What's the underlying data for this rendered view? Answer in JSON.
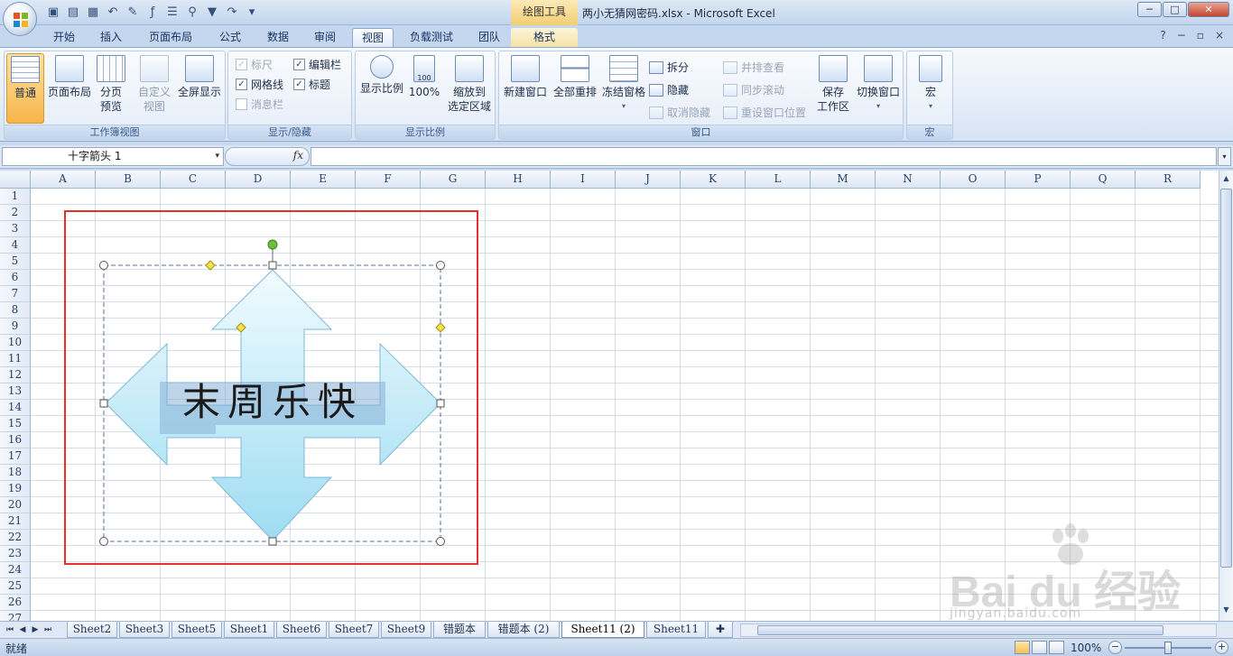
{
  "titlebar": {
    "context_tool": "绘图工具",
    "window_title": "两小无猜网密码.xlsx - Microsoft Excel",
    "min": "─",
    "max": "□",
    "close": "✕"
  },
  "tabs": [
    "开始",
    "插入",
    "页面布局",
    "公式",
    "数据",
    "审阅",
    "视图",
    "负载测试",
    "团队",
    "格式"
  ],
  "active_tab": "视图",
  "help": {
    "help": "?",
    "min": "−",
    "restore": "▫",
    "close": "×"
  },
  "ribbon": {
    "workbook_views": {
      "label": "工作簿视图",
      "normal": "普通",
      "page_layout": "页面布局",
      "page_break_l1": "分页",
      "page_break_l2": "预览",
      "custom_l1": "自定义",
      "custom_l2": "视图",
      "full_screen": "全屏显示"
    },
    "show_hide": {
      "label": "显示/隐藏",
      "ruler": "标尺",
      "gridlines": "网格线",
      "message_bar": "消息栏",
      "formula_bar": "编辑栏",
      "headings": "标题",
      "check": "✓"
    },
    "zoom": {
      "label": "显示比例",
      "zoom": "显示比例",
      "hundred": "100%",
      "hundred_icon": "100",
      "zoom_sel_l1": "缩放到",
      "zoom_sel_l2": "选定区域"
    },
    "window": {
      "label": "窗口",
      "new_window": "新建窗口",
      "arrange_all": "全部重排",
      "freeze": "冻结窗格",
      "split": "拆分",
      "hide": "隐藏",
      "unhide": "取消隐藏",
      "side_by_side": "并排查看",
      "sync_scroll": "同步滚动",
      "reset_pos": "重设窗口位置",
      "save_ws_l1": "保存",
      "save_ws_l2": "工作区",
      "switch": "切换窗口",
      "dropdown": "▾"
    },
    "macros": {
      "label": "宏",
      "macros": "宏"
    }
  },
  "formula_bar": {
    "name_box": "十字箭头 1",
    "fx": "fx",
    "dropdown": "▾",
    "expand": "▾"
  },
  "columns": [
    "A",
    "B",
    "C",
    "D",
    "E",
    "F",
    "G",
    "H",
    "I",
    "J",
    "K",
    "L",
    "M",
    "N",
    "O",
    "P",
    "Q",
    "R"
  ],
  "rows": [
    "1",
    "2",
    "3",
    "4",
    "5",
    "6",
    "7",
    "8",
    "9",
    "10",
    "11",
    "12",
    "13",
    "14",
    "15",
    "16",
    "17",
    "18",
    "19",
    "20",
    "21",
    "22",
    "23",
    "24",
    "25",
    "26",
    "27"
  ],
  "shape": {
    "text": "末周乐快",
    "fill_top": "#f0fbff",
    "fill_bottom": "#9edcf2",
    "stroke": "#7fb8d6"
  },
  "sheet_tabs": [
    "Sheet2",
    "Sheet3",
    "Sheet5",
    "Sheet1",
    "Sheet6",
    "Sheet7",
    "Sheet9",
    "错题本",
    "错题本 (2)",
    "Sheet11 (2)",
    "Sheet11"
  ],
  "active_sheet": "Sheet11 (2)",
  "sheet_nav": [
    "⏮",
    "◀",
    "▶",
    "⏭"
  ],
  "status": {
    "ready": "就绪",
    "zoom": "100%",
    "minus": "−",
    "plus": "+"
  },
  "watermark": {
    "brand": "Bai du 经验",
    "url": "jingyan.baidu.com"
  }
}
